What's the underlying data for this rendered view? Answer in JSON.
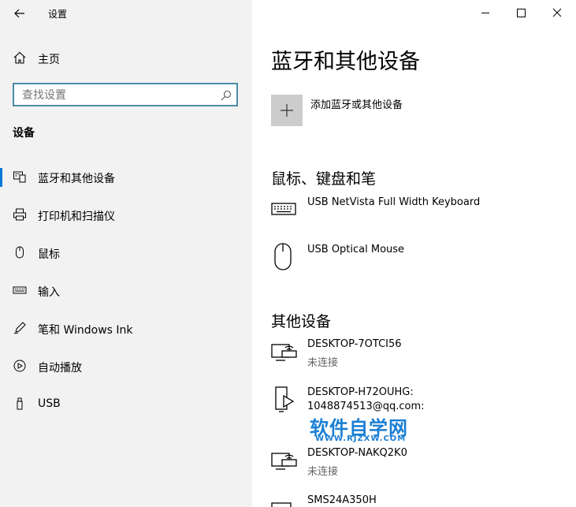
{
  "window": {
    "title": "设置",
    "back_icon": "back-arrow-icon",
    "minimize_icon": "minimize-icon",
    "maximize_icon": "maximize-icon",
    "close_icon": "close-icon"
  },
  "sidebar": {
    "home_label": "主页",
    "search_placeholder": "查找设置",
    "section_title": "设备",
    "items": [
      {
        "label": "蓝牙和其他设备",
        "icon": "bluetooth-devices-icon",
        "selected": true
      },
      {
        "label": "打印机和扫描仪",
        "icon": "printer-icon",
        "selected": false
      },
      {
        "label": "鼠标",
        "icon": "mouse-icon",
        "selected": false
      },
      {
        "label": "输入",
        "icon": "keyboard-icon",
        "selected": false
      },
      {
        "label": "笔和 Windows Ink",
        "icon": "pen-icon",
        "selected": false
      },
      {
        "label": "自动播放",
        "icon": "autoplay-icon",
        "selected": false
      },
      {
        "label": "USB",
        "icon": "usb-icon",
        "selected": false
      }
    ],
    "accent_color": "#0078d7"
  },
  "main": {
    "page_title": "蓝牙和其他设备",
    "add_device_label": "添加蓝牙或其他设备",
    "mouse_keyboard_heading": "鼠标、键盘和笔",
    "input_devices": [
      {
        "name": "USB NetVista Full Width Keyboard",
        "icon": "keyboard-device-icon"
      },
      {
        "name": "USB Optical Mouse",
        "icon": "mouse-device-icon"
      }
    ],
    "other_heading": "其他设备",
    "other_devices": [
      {
        "name": "DESKTOP-7OTCI56",
        "status": "未连接",
        "icon": "network-display-icon"
      },
      {
        "name": "DESKTOP-H72OUHG:",
        "status": "1048874513@qq.com:",
        "icon": "media-device-icon"
      },
      {
        "name": "DESKTOP-NAKQ2K0",
        "status": "未连接",
        "icon": "network-display-icon"
      },
      {
        "name": "SMS24A350H",
        "status": "",
        "icon": "monitor-icon"
      }
    ]
  },
  "watermark": {
    "text": "软件自学网",
    "url": "WWW.RJZXW.COM"
  }
}
